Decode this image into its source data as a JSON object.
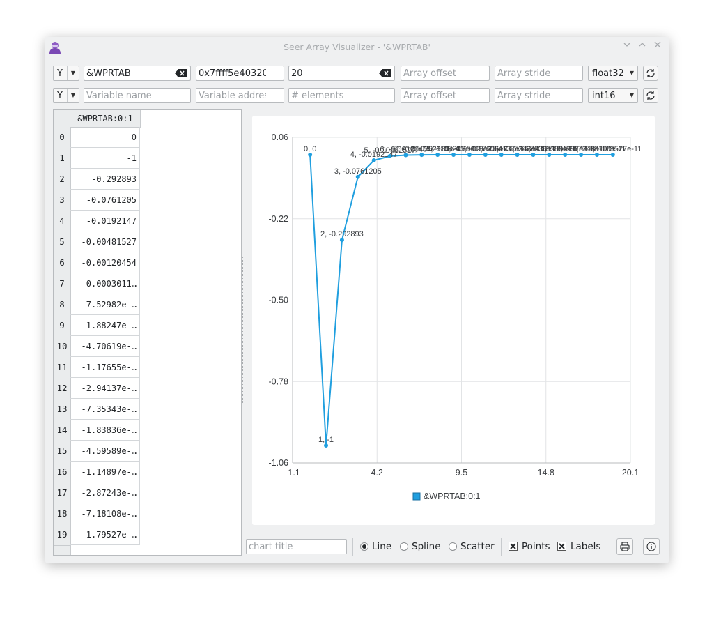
{
  "window": {
    "title": "Seer Array Visualizer - '&WPRTAB'"
  },
  "row1": {
    "axis": "Y",
    "variable": "&WPRTAB",
    "address": "0x7ffff5e40320",
    "elements": "20",
    "offset_placeholder": "Array offset",
    "stride_placeholder": "Array stride",
    "type": "float32"
  },
  "row2": {
    "axis": "Y",
    "variable_placeholder": "Variable name",
    "address_placeholder": "Variable address",
    "elements_placeholder": "# elements",
    "offset_placeholder": "Array offset",
    "stride_placeholder": "Array stride",
    "type": "int16"
  },
  "table": {
    "column_header": "&WPRTAB:0:1",
    "row_numbers": [
      "0",
      "1",
      "2",
      "3",
      "4",
      "5",
      "6",
      "7",
      "8",
      "9",
      "10",
      "11",
      "12",
      "13",
      "14",
      "15",
      "16",
      "17",
      "18",
      "19"
    ],
    "values": [
      "0",
      "-1",
      "-0.292893",
      "-0.0761205",
      "-0.0192147",
      "-0.00481527",
      "-0.00120454",
      "-0.0003011…",
      "-7.52982e-…",
      "-1.88247e-…",
      "-4.70619e-…",
      "-1.17655e-…",
      "-2.94137e-…",
      "-7.35343e-…",
      "-1.83836e-…",
      "-4.59589e-…",
      "-1.14897e-…",
      "-2.87243e-…",
      "-7.18108e-…",
      "-1.79527e-…"
    ]
  },
  "chart_data": {
    "type": "line",
    "title": "",
    "xlabel": "",
    "ylabel": "",
    "xlim": [
      -1.1,
      20.1
    ],
    "ylim": [
      -1.06,
      0.06
    ],
    "x_ticks": [
      "-1.1",
      "4.2",
      "9.5",
      "14.8",
      "20.1"
    ],
    "y_ticks": [
      "0.06",
      "-0.22",
      "-0.50",
      "-0.78",
      "-1.06"
    ],
    "grid": true,
    "legend_position": "bottom",
    "series": [
      {
        "name": "&WPRTAB:0:1",
        "color": "#209fdf",
        "x": [
          0,
          1,
          2,
          3,
          4,
          5,
          6,
          7,
          8,
          9,
          10,
          11,
          12,
          13,
          14,
          15,
          16,
          17,
          18,
          19
        ],
        "y": [
          0,
          -1,
          -0.292893,
          -0.0761205,
          -0.0192147,
          -0.00481527,
          -0.00120454,
          -0.00030113,
          -7.52982e-05,
          -1.88247e-05,
          -4.70619e-06,
          -1.17655e-06,
          -2.94137e-07,
          -7.35343e-08,
          -1.83836e-08,
          -4.59589e-09,
          -1.14897e-09,
          -2.87243e-10,
          -7.18108e-11,
          -1.79527e-11
        ],
        "point_labels": [
          "0, 0",
          "1, -1",
          "2, -0.292893",
          "3, -0.0761205",
          "4, -0.0192147",
          "5, -0.00481527",
          "6, -0.00120454",
          "7, -0.000301135",
          "8, -7.52982e-05",
          "9, -1.88247e-05",
          "10, -4.70619e-06",
          "11, -1.17655e-06",
          "12, -2.94137e-07",
          "13, -7.35343e-08",
          "14, -1.83836e-08",
          "15, -4.59589e-09",
          "16, -1.14897e-09",
          "17, -2.87243e-10",
          "18, -7.18108e-11",
          "19, -1.79527e-11"
        ]
      }
    ]
  },
  "bottom": {
    "chart_title_placeholder": "chart title",
    "line_label": "Line",
    "spline_label": "Spline",
    "scatter_label": "Scatter",
    "points_label": "Points",
    "labels_label": "Labels",
    "selected_mode": "Line"
  }
}
